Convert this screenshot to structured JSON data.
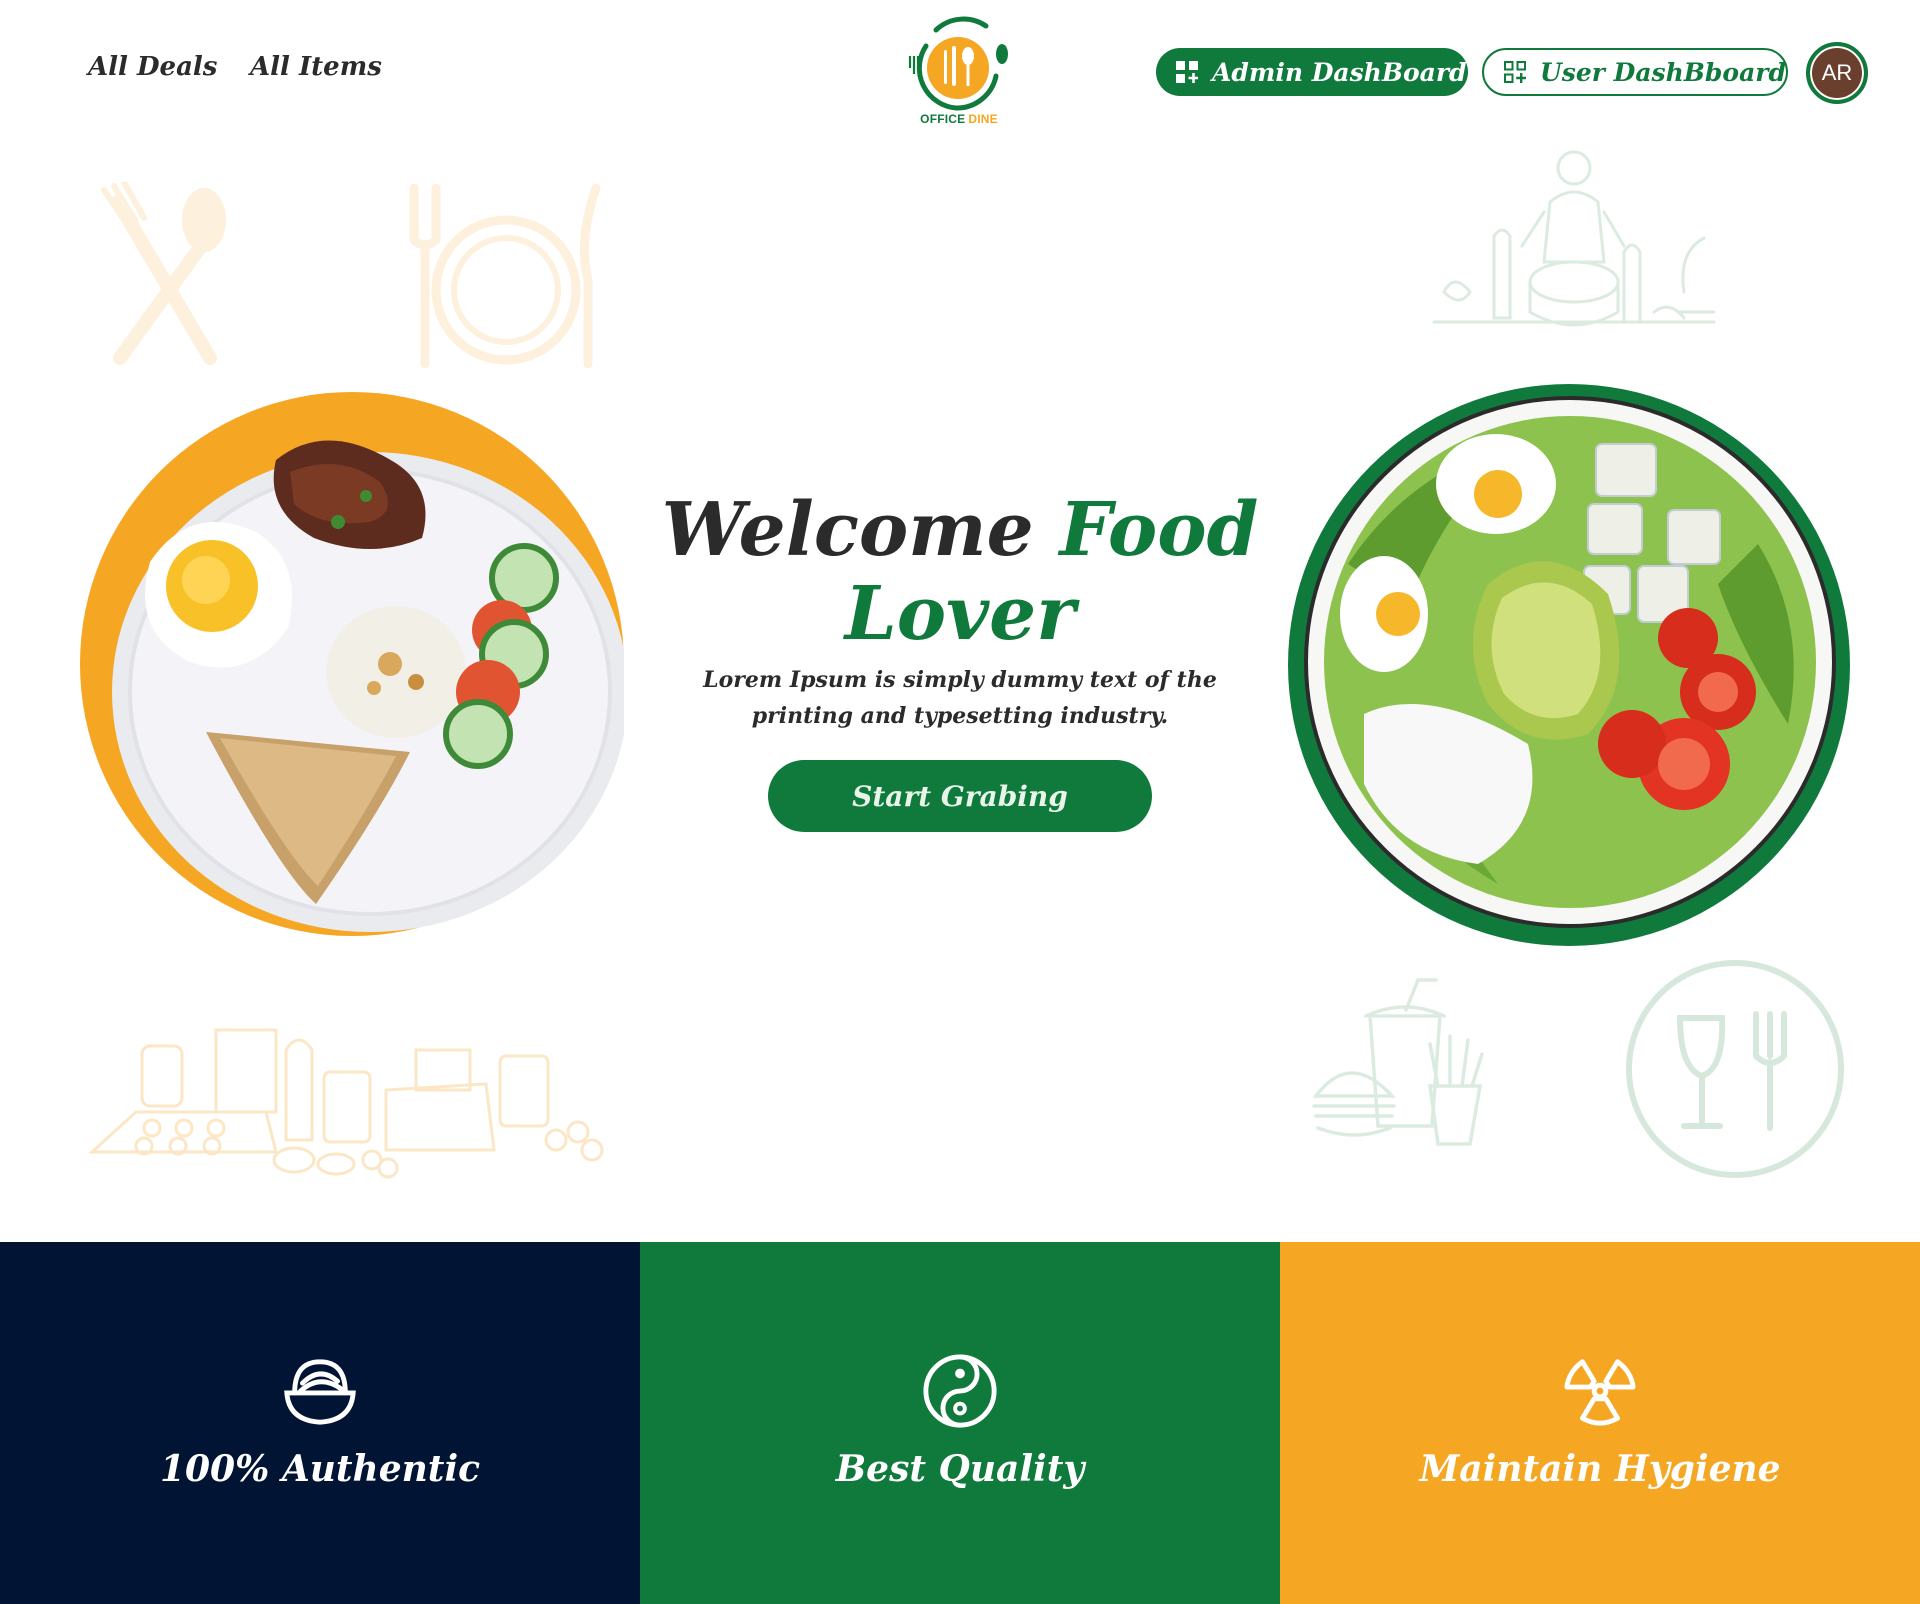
{
  "header": {
    "nav": [
      {
        "label": "All Deals"
      },
      {
        "label": "All Items"
      }
    ],
    "logo": {
      "word1": "OFFICE",
      "word2": "DINE"
    },
    "admin_button": {
      "label": "Admin DashBoard",
      "icon": "dashboard-add-icon"
    },
    "user_button": {
      "label": "User DashBboard",
      "icon": "qr-add-icon"
    },
    "avatar_initials": "AR"
  },
  "hero": {
    "title_part1": "Welcome",
    "title_part2": "Food",
    "title_line2": "Lover",
    "subtitle": "Lorem Ipsum is simply dummy text of the printing and typesetting industry.",
    "cta_label": "Start Grabing",
    "left_image": "breakfast-plate",
    "right_image": "salad-bowl"
  },
  "features": [
    {
      "label": "100% Authentic",
      "icon": "bowl-icon",
      "color": "#011433"
    },
    {
      "label": "Best Quality",
      "icon": "yin-yang-icon",
      "color": "#107a3d"
    },
    {
      "label": "Maintain Hygiene",
      "icon": "radiation-icon",
      "color": "#f5a623"
    }
  ],
  "colors": {
    "brand_green": "#107a3d",
    "brand_orange": "#f5a623",
    "navy": "#011433",
    "text": "#2b2b2b"
  }
}
